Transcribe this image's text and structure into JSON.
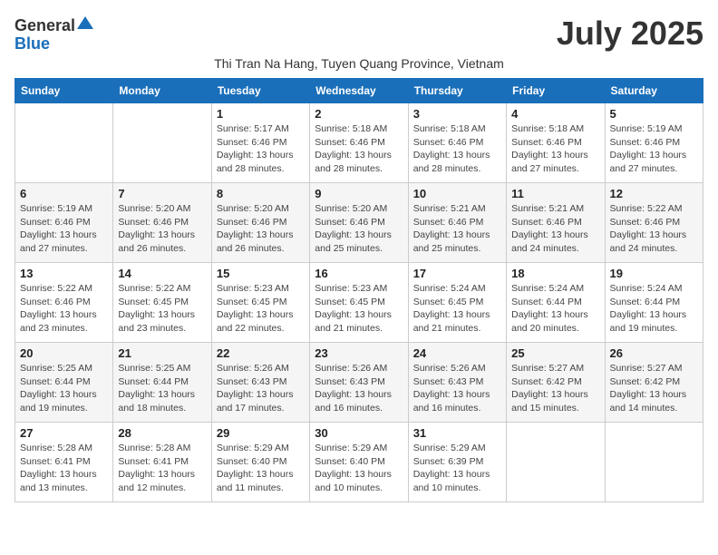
{
  "logo": {
    "general": "General",
    "blue": "Blue"
  },
  "title": "July 2025",
  "subtitle": "Thi Tran Na Hang, Tuyen Quang Province, Vietnam",
  "days_of_week": [
    "Sunday",
    "Monday",
    "Tuesday",
    "Wednesday",
    "Thursday",
    "Friday",
    "Saturday"
  ],
  "weeks": [
    [
      {
        "day": "",
        "info": ""
      },
      {
        "day": "",
        "info": ""
      },
      {
        "day": "1",
        "info": "Sunrise: 5:17 AM\nSunset: 6:46 PM\nDaylight: 13 hours and 28 minutes."
      },
      {
        "day": "2",
        "info": "Sunrise: 5:18 AM\nSunset: 6:46 PM\nDaylight: 13 hours and 28 minutes."
      },
      {
        "day": "3",
        "info": "Sunrise: 5:18 AM\nSunset: 6:46 PM\nDaylight: 13 hours and 28 minutes."
      },
      {
        "day": "4",
        "info": "Sunrise: 5:18 AM\nSunset: 6:46 PM\nDaylight: 13 hours and 27 minutes."
      },
      {
        "day": "5",
        "info": "Sunrise: 5:19 AM\nSunset: 6:46 PM\nDaylight: 13 hours and 27 minutes."
      }
    ],
    [
      {
        "day": "6",
        "info": "Sunrise: 5:19 AM\nSunset: 6:46 PM\nDaylight: 13 hours and 27 minutes."
      },
      {
        "day": "7",
        "info": "Sunrise: 5:20 AM\nSunset: 6:46 PM\nDaylight: 13 hours and 26 minutes."
      },
      {
        "day": "8",
        "info": "Sunrise: 5:20 AM\nSunset: 6:46 PM\nDaylight: 13 hours and 26 minutes."
      },
      {
        "day": "9",
        "info": "Sunrise: 5:20 AM\nSunset: 6:46 PM\nDaylight: 13 hours and 25 minutes."
      },
      {
        "day": "10",
        "info": "Sunrise: 5:21 AM\nSunset: 6:46 PM\nDaylight: 13 hours and 25 minutes."
      },
      {
        "day": "11",
        "info": "Sunrise: 5:21 AM\nSunset: 6:46 PM\nDaylight: 13 hours and 24 minutes."
      },
      {
        "day": "12",
        "info": "Sunrise: 5:22 AM\nSunset: 6:46 PM\nDaylight: 13 hours and 24 minutes."
      }
    ],
    [
      {
        "day": "13",
        "info": "Sunrise: 5:22 AM\nSunset: 6:46 PM\nDaylight: 13 hours and 23 minutes."
      },
      {
        "day": "14",
        "info": "Sunrise: 5:22 AM\nSunset: 6:45 PM\nDaylight: 13 hours and 23 minutes."
      },
      {
        "day": "15",
        "info": "Sunrise: 5:23 AM\nSunset: 6:45 PM\nDaylight: 13 hours and 22 minutes."
      },
      {
        "day": "16",
        "info": "Sunrise: 5:23 AM\nSunset: 6:45 PM\nDaylight: 13 hours and 21 minutes."
      },
      {
        "day": "17",
        "info": "Sunrise: 5:24 AM\nSunset: 6:45 PM\nDaylight: 13 hours and 21 minutes."
      },
      {
        "day": "18",
        "info": "Sunrise: 5:24 AM\nSunset: 6:44 PM\nDaylight: 13 hours and 20 minutes."
      },
      {
        "day": "19",
        "info": "Sunrise: 5:24 AM\nSunset: 6:44 PM\nDaylight: 13 hours and 19 minutes."
      }
    ],
    [
      {
        "day": "20",
        "info": "Sunrise: 5:25 AM\nSunset: 6:44 PM\nDaylight: 13 hours and 19 minutes."
      },
      {
        "day": "21",
        "info": "Sunrise: 5:25 AM\nSunset: 6:44 PM\nDaylight: 13 hours and 18 minutes."
      },
      {
        "day": "22",
        "info": "Sunrise: 5:26 AM\nSunset: 6:43 PM\nDaylight: 13 hours and 17 minutes."
      },
      {
        "day": "23",
        "info": "Sunrise: 5:26 AM\nSunset: 6:43 PM\nDaylight: 13 hours and 16 minutes."
      },
      {
        "day": "24",
        "info": "Sunrise: 5:26 AM\nSunset: 6:43 PM\nDaylight: 13 hours and 16 minutes."
      },
      {
        "day": "25",
        "info": "Sunrise: 5:27 AM\nSunset: 6:42 PM\nDaylight: 13 hours and 15 minutes."
      },
      {
        "day": "26",
        "info": "Sunrise: 5:27 AM\nSunset: 6:42 PM\nDaylight: 13 hours and 14 minutes."
      }
    ],
    [
      {
        "day": "27",
        "info": "Sunrise: 5:28 AM\nSunset: 6:41 PM\nDaylight: 13 hours and 13 minutes."
      },
      {
        "day": "28",
        "info": "Sunrise: 5:28 AM\nSunset: 6:41 PM\nDaylight: 13 hours and 12 minutes."
      },
      {
        "day": "29",
        "info": "Sunrise: 5:29 AM\nSunset: 6:40 PM\nDaylight: 13 hours and 11 minutes."
      },
      {
        "day": "30",
        "info": "Sunrise: 5:29 AM\nSunset: 6:40 PM\nDaylight: 13 hours and 10 minutes."
      },
      {
        "day": "31",
        "info": "Sunrise: 5:29 AM\nSunset: 6:39 PM\nDaylight: 13 hours and 10 minutes."
      },
      {
        "day": "",
        "info": ""
      },
      {
        "day": "",
        "info": ""
      }
    ]
  ]
}
